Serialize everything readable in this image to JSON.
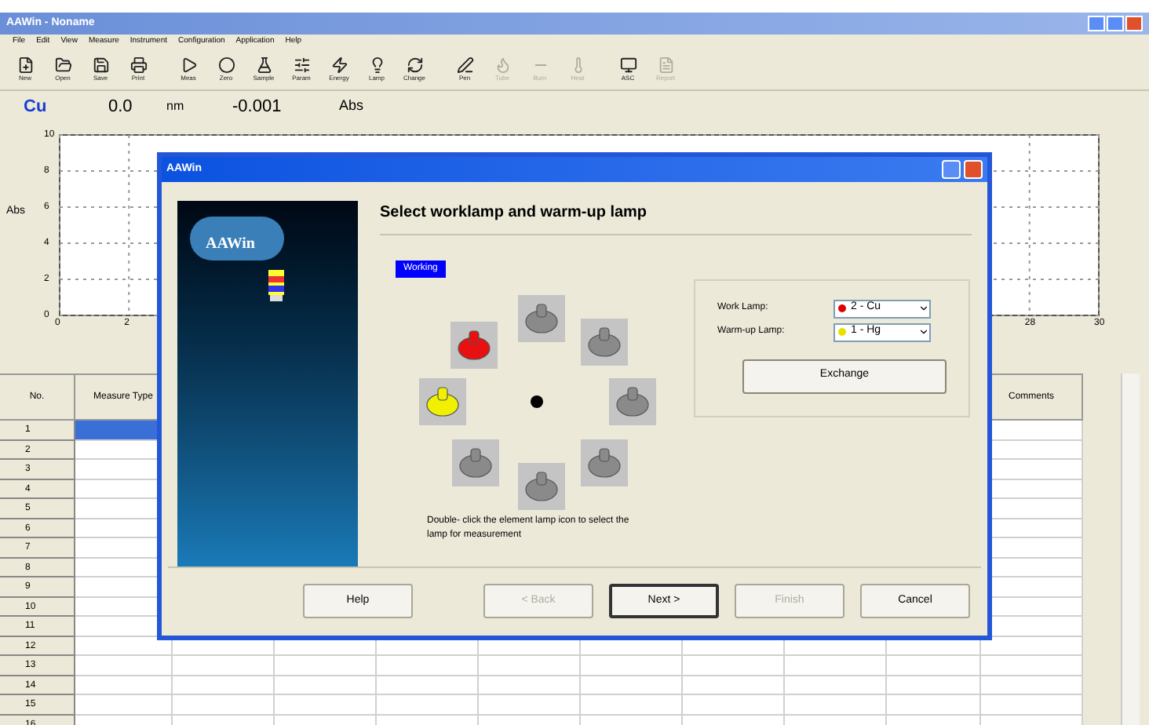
{
  "window": {
    "title": "AAWin - Noname"
  },
  "menu": [
    "File",
    "Edit",
    "View",
    "Measure",
    "Instrument",
    "Configuration",
    "Application",
    "Help"
  ],
  "toolbar": [
    {
      "label": "New",
      "disabled": false
    },
    {
      "label": "Open",
      "disabled": false
    },
    {
      "label": "Save",
      "disabled": false
    },
    {
      "label": "Print",
      "disabled": false
    },
    {
      "label": "Meas",
      "disabled": false
    },
    {
      "label": "Zero",
      "disabled": false
    },
    {
      "label": "Sample",
      "disabled": false
    },
    {
      "label": "Param",
      "disabled": false
    },
    {
      "label": "Energy",
      "disabled": false
    },
    {
      "label": "Lamp",
      "disabled": false
    },
    {
      "label": "Change",
      "disabled": false
    },
    {
      "label": "Pen",
      "disabled": false
    },
    {
      "label": "Tube",
      "disabled": true
    },
    {
      "label": "Burn",
      "disabled": true
    },
    {
      "label": "Heat",
      "disabled": true
    },
    {
      "label": "ASC",
      "disabled": false
    },
    {
      "label": "Report",
      "disabled": true
    }
  ],
  "readout": {
    "element": "Cu",
    "wavelength": "0.0",
    "wavelength_unit": "nm",
    "absorbance": "-0.001",
    "absorbance_unit": "Abs"
  },
  "chart_data": {
    "type": "line",
    "ylabel": "Abs",
    "xlim": [
      0,
      30
    ],
    "ylim": [
      0,
      10
    ],
    "xticks": [
      0,
      2,
      28,
      30
    ],
    "yticks": [
      0,
      2,
      4,
      6,
      8,
      10
    ],
    "grid": true
  },
  "table": {
    "columns": [
      "No.",
      "Measure Type",
      "Comments"
    ],
    "rows": [
      {
        "no": "1",
        "selected": true
      },
      {
        "no": "2",
        "selected": false
      },
      {
        "no": "3",
        "selected": false
      },
      {
        "no": "4",
        "selected": false
      },
      {
        "no": "5",
        "selected": false
      },
      {
        "no": "6",
        "selected": false
      },
      {
        "no": "7",
        "selected": false
      },
      {
        "no": "8",
        "selected": false
      },
      {
        "no": "9",
        "selected": false
      },
      {
        "no": "10",
        "selected": false
      },
      {
        "no": "11",
        "selected": false
      },
      {
        "no": "12",
        "selected": false
      },
      {
        "no": "13",
        "selected": false
      },
      {
        "no": "14",
        "selected": false
      },
      {
        "no": "15",
        "selected": false
      },
      {
        "no": "16",
        "selected": false
      }
    ]
  },
  "dialog": {
    "title": "AAWin",
    "banner_logo": "AAWin",
    "heading": "Select worklamp and warm-up lamp",
    "position_label": "Working",
    "lamps": [
      {
        "kind": "work"
      },
      {
        "kind": "empty"
      },
      {
        "kind": "empty"
      },
      {
        "kind": "empty"
      },
      {
        "kind": "empty"
      },
      {
        "kind": "empty"
      },
      {
        "kind": "empty"
      },
      {
        "kind": "warmup"
      }
    ],
    "work_lamp": {
      "label": "Work Lamp:",
      "value": "2 - Cu",
      "color": "#e00000"
    },
    "warmup_lamp": {
      "label": "Warm-up Lamp:",
      "value": "1 - Hg",
      "color": "#e8e000"
    },
    "exchange_button": "Exchange",
    "note": "Double- click the element lamp icon to select the lamp for measurement",
    "buttons": [
      {
        "label": "Help",
        "kind": "normal",
        "disabled": false
      },
      {
        "label": "< Back",
        "kind": "normal",
        "disabled": true
      },
      {
        "label": "Next >",
        "kind": "default",
        "disabled": false
      },
      {
        "label": "Finish",
        "kind": "normal",
        "disabled": true
      },
      {
        "label": "Cancel",
        "kind": "normal",
        "disabled": false
      }
    ]
  }
}
